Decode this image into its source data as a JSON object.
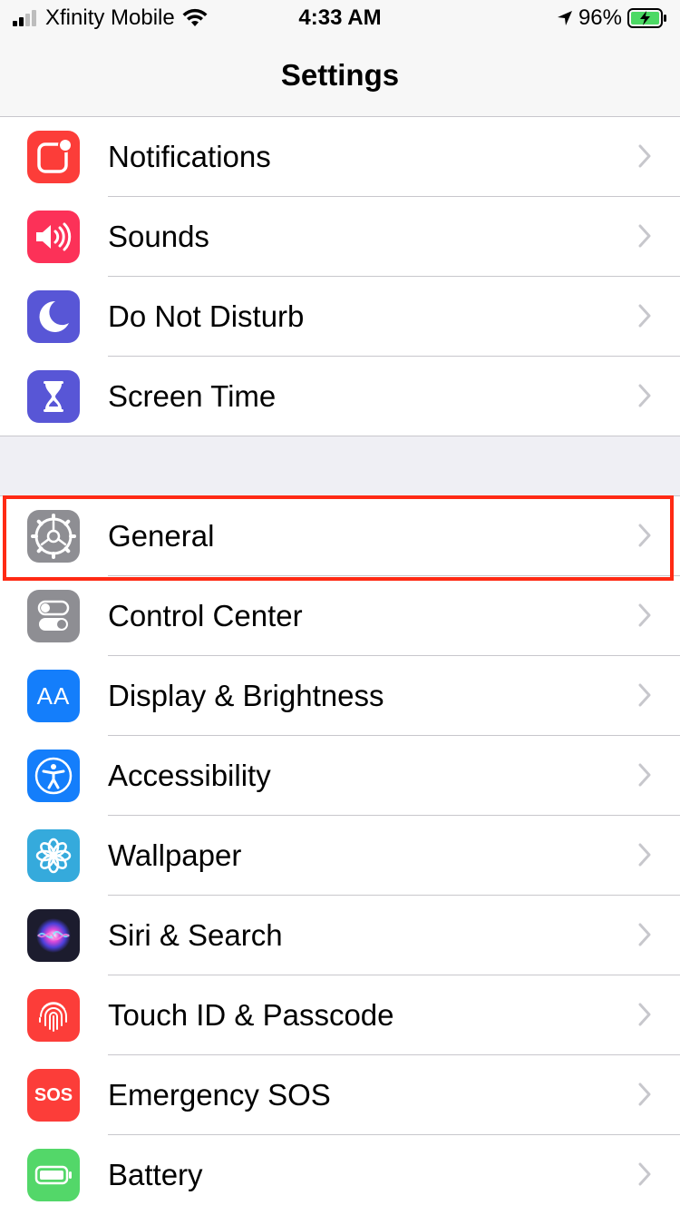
{
  "status_bar": {
    "carrier": "Xfinity Mobile",
    "time": "4:33 AM",
    "battery_percent": "96%",
    "signal_bars": 4,
    "signal_bars_active": 2,
    "icons": [
      "signal-icon",
      "wifi-icon",
      "location-arrow-icon",
      "battery-charging-icon"
    ]
  },
  "nav": {
    "title": "Settings"
  },
  "groups": [
    {
      "items": [
        {
          "label": "Notifications",
          "icon": "notifications-icon",
          "color": "#fc3d39"
        },
        {
          "label": "Sounds",
          "icon": "speaker-icon",
          "color": "#fc3158"
        },
        {
          "label": "Do Not Disturb",
          "icon": "moon-icon",
          "color": "#5856d6"
        },
        {
          "label": "Screen Time",
          "icon": "hourglass-icon",
          "color": "#5856d6"
        }
      ]
    },
    {
      "items": [
        {
          "label": "General",
          "icon": "gear-icon",
          "color": "#8e8e93",
          "highlighted": true
        },
        {
          "label": "Control Center",
          "icon": "toggles-icon",
          "color": "#8e8e93"
        },
        {
          "label": "Display & Brightness",
          "icon": "text-size-icon",
          "color": "#147efb",
          "glyph": "AA"
        },
        {
          "label": "Accessibility",
          "icon": "accessibility-icon",
          "color": "#147efb"
        },
        {
          "label": "Wallpaper",
          "icon": "flower-icon",
          "color": "#35aadc"
        },
        {
          "label": "Siri & Search",
          "icon": "siri-icon",
          "color": "#1c1c2e"
        },
        {
          "label": "Touch ID & Passcode",
          "icon": "fingerprint-icon",
          "color": "#fc3d39"
        },
        {
          "label": "Emergency SOS",
          "icon": "sos-icon",
          "color": "#fc3d39",
          "glyph": "SOS"
        },
        {
          "label": "Battery",
          "icon": "battery-icon",
          "color": "#53d769"
        }
      ]
    }
  ],
  "colors": {
    "background": "#efeff4",
    "highlight_border": "#ff2a14",
    "chevron": "#c7c7cc",
    "separator": "#c8c7cc"
  }
}
